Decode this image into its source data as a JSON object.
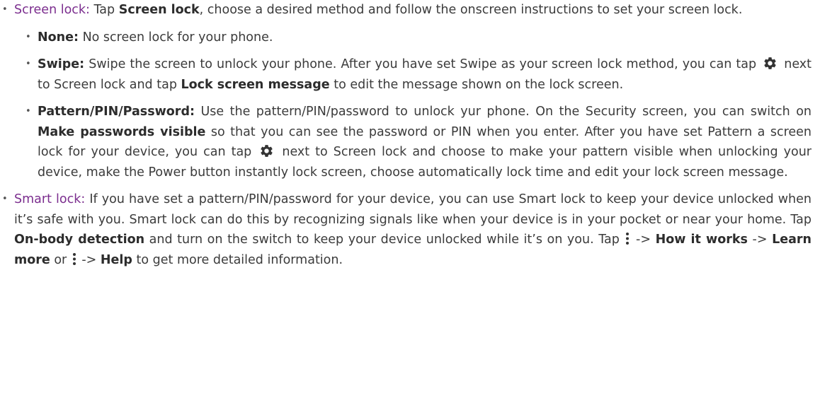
{
  "screen_lock": {
    "heading": "Screen lock:",
    "t1": " Tap ",
    "b1": "Screen lock",
    "t2": ", choose a desired method and follow the onscreen instructions to set your screen lock."
  },
  "none": {
    "label": "None:",
    "text": " No screen lock for your phone."
  },
  "swipe": {
    "label": "Swipe:",
    "t1": " Swipe the screen to unlock your phone. After you have set Swipe as your screen lock method, you can tap ",
    "t2": " next to Screen lock and tap ",
    "b1": "Lock screen message",
    "t3": " to edit the message shown on the lock screen."
  },
  "pattern": {
    "label": "Pattern/PIN/Password:",
    "t1": " Use the pattern/PIN/password to unlock yur phone. On the Security screen, you can switch on ",
    "b1": "Make passwords visible",
    "t2": " so that you can see the password or PIN when you enter. After you have set Pattern a screen lock for your device, you can tap ",
    "t3": " next to Screen lock and choose to make your pattern visible when unlocking your device, make the Power button instantly lock screen, choose automatically lock time and edit your lock screen message."
  },
  "smart_lock": {
    "heading": "Smart lock:",
    "t1": " If you have set a pattern/PIN/password for your device, you can use Smart lock to keep your device unlocked when it’s safe with you. Smart lock can do this by recognizing signals like when your device is in your pocket or near your home. Tap ",
    "b1": "On-body detection",
    "t2": " and turn on the switch to keep your device unlocked while it’s on you. Tap ",
    "arrow1": " -> ",
    "b2": "How it works",
    "arrow2": " -> ",
    "b3": "Learn more",
    "or": " or ",
    "arrow3": " -> ",
    "b4": "Help",
    "t3": " to get more detailed information."
  },
  "bullet_char": "•",
  "colors": {
    "accent": "#7b2d8e",
    "text": "#3b3b3b"
  },
  "icons": [
    "gear-icon",
    "more-vert-icon"
  ]
}
